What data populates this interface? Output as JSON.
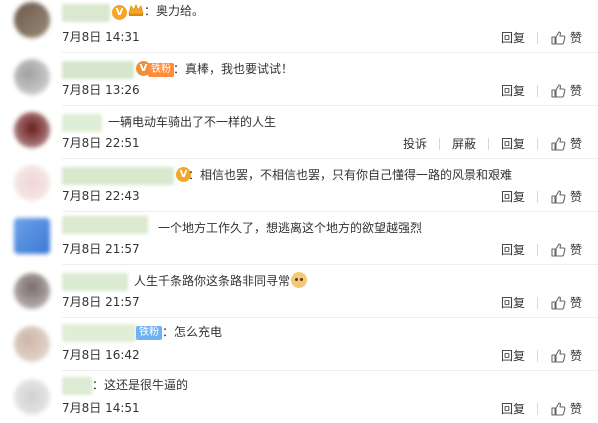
{
  "ui": {
    "reply_label": "回复",
    "like_label": "赞",
    "report_label": "投诉",
    "block_label": "屏蔽"
  },
  "colors": {
    "text": "#333333",
    "vip_orange": "#f6a623",
    "fan_badge_orange": "#ff8c3a",
    "fan_badge_blue": "#6cb2f5",
    "divider": "#eeeeee"
  },
  "comments": [
    {
      "text": "：奥力给。",
      "time": "7月8日 14:31",
      "badges": [
        "vip-icon",
        "crown-icon"
      ]
    },
    {
      "text": "：真棒，我也要试试！",
      "time": "7月8日 13:26",
      "badges": [
        "vip-icon",
        "fan-badge"
      ],
      "fan_badge_label": "铁粉"
    },
    {
      "text": "一辆电动车骑出了不一样的人生",
      "time": "7月8日 22:51",
      "badges": [],
      "show_report": true
    },
    {
      "text": "：相信也罢，不相信也罢，只有你自己懂得一路的风景和艰难",
      "time": "7月8日 22:43",
      "badges": [
        "vip-icon"
      ]
    },
    {
      "text": "一个地方工作久了，想逃离这个地方的欲望越强烈",
      "time": "7月8日 21:57",
      "badges": []
    },
    {
      "text": "人生千条路你这条路非同寻常",
      "time": "7月8日 21:57",
      "badges": [],
      "emoji": "cat-emoji"
    },
    {
      "text": "：怎么充电",
      "time": "7月8日 16:42",
      "badges": [
        "fan-badge"
      ],
      "fan_badge_label": "铁粉"
    },
    {
      "text": "：这还是很牛逼的",
      "time": "7月8日 14:51",
      "badges": []
    }
  ]
}
